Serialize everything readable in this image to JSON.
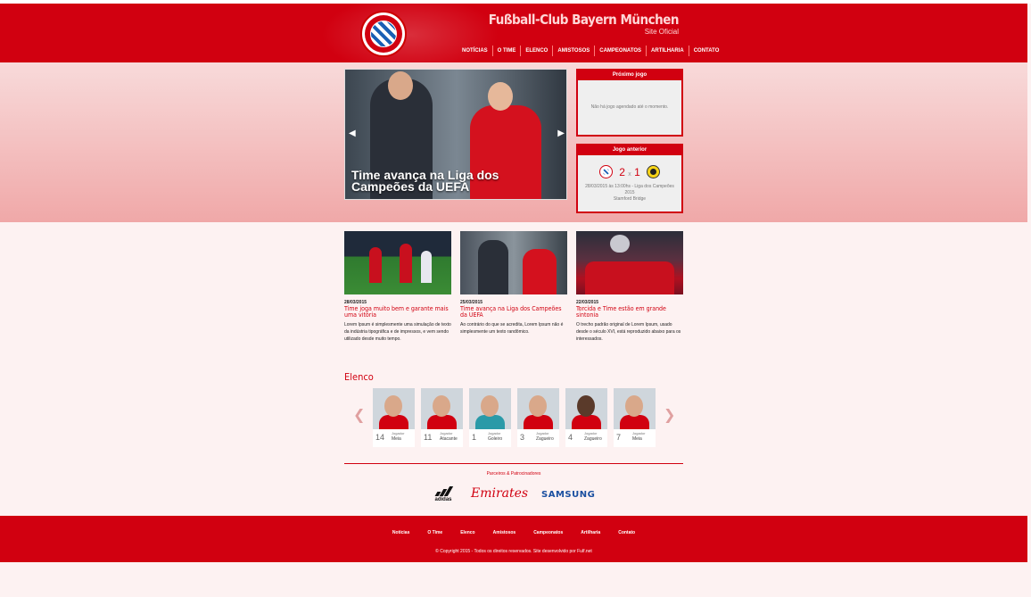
{
  "header": {
    "club_name": "Fußball-Club Bayern München",
    "club_sub": "Site Oficial",
    "logo_text": "FC BAYERN MÜNCHEN",
    "nav": [
      "NOTÍCIAS",
      "O TIME",
      "ELENCO",
      "AMISTOSOS",
      "CAMPEONATOS",
      "ARTILHARIA",
      "CONTATO"
    ]
  },
  "hero": {
    "caption": "Time avança na Liga dos Campeões da UEFA"
  },
  "next_game": {
    "title": "Próximo jogo",
    "message": "Não há jogo agendado até o momento."
  },
  "last_game": {
    "title": "Jogo anterior",
    "home_score": "2",
    "separator": "x",
    "away_score": "1",
    "details": "28/03/2015 às 13:00hs - Liga dos Campeões 2015",
    "venue": "Stamford Bridge"
  },
  "news": [
    {
      "date": "28/03/2015",
      "title": "Time joga muito bem e garante mais uma vitória",
      "text": "Lorem Ipsum é simplesmente uma simulação de texto da indústria tipográfica e de impressos, e vem sendo utilizado desde muito tempo."
    },
    {
      "date": "25/03/2015",
      "title": "Time avança na Liga dos Campeões da UEFA",
      "text": "Ao contrário do que se acredita, Lorem Ipsum não é simplesmente um texto randômico."
    },
    {
      "date": "22/03/2015",
      "title": "Torcida e Time estão em grande sintonia",
      "text": "O trecho padrão original de Lorem Ipsum, usado desde o século XVI, está reproduzido abaixo para os interessados."
    }
  ],
  "squad": {
    "title": "Elenco",
    "players": [
      {
        "number": "14",
        "role": "Jogador",
        "position": "Meia"
      },
      {
        "number": "11",
        "role": "Jogador",
        "position": "Atacante"
      },
      {
        "number": "1",
        "role": "Jogador",
        "position": "Goleiro"
      },
      {
        "number": "3",
        "role": "Jogador",
        "position": "Zagueiro"
      },
      {
        "number": "4",
        "role": "Jogador",
        "position": "Zagueiro"
      },
      {
        "number": "7",
        "role": "Jogador",
        "position": "Meia"
      }
    ]
  },
  "partners": {
    "title": "Parceiros & Patrocinadores",
    "brands": [
      "adidas",
      "Emirates",
      "SAMSUNG"
    ]
  },
  "footer": {
    "nav": [
      "Notícias",
      "O Time",
      "Elenco",
      "Amistosos",
      "Campeonatos",
      "Artilharia",
      "Contato"
    ],
    "copyright": "© Copyright 2015 - Todos os direitos reservados. Site desenvolvido por Fulf.net"
  },
  "colors": {
    "brand_red": "#d10010",
    "bayern_blue": "#1a5fb4",
    "dortmund_yellow": "#f7d417"
  }
}
